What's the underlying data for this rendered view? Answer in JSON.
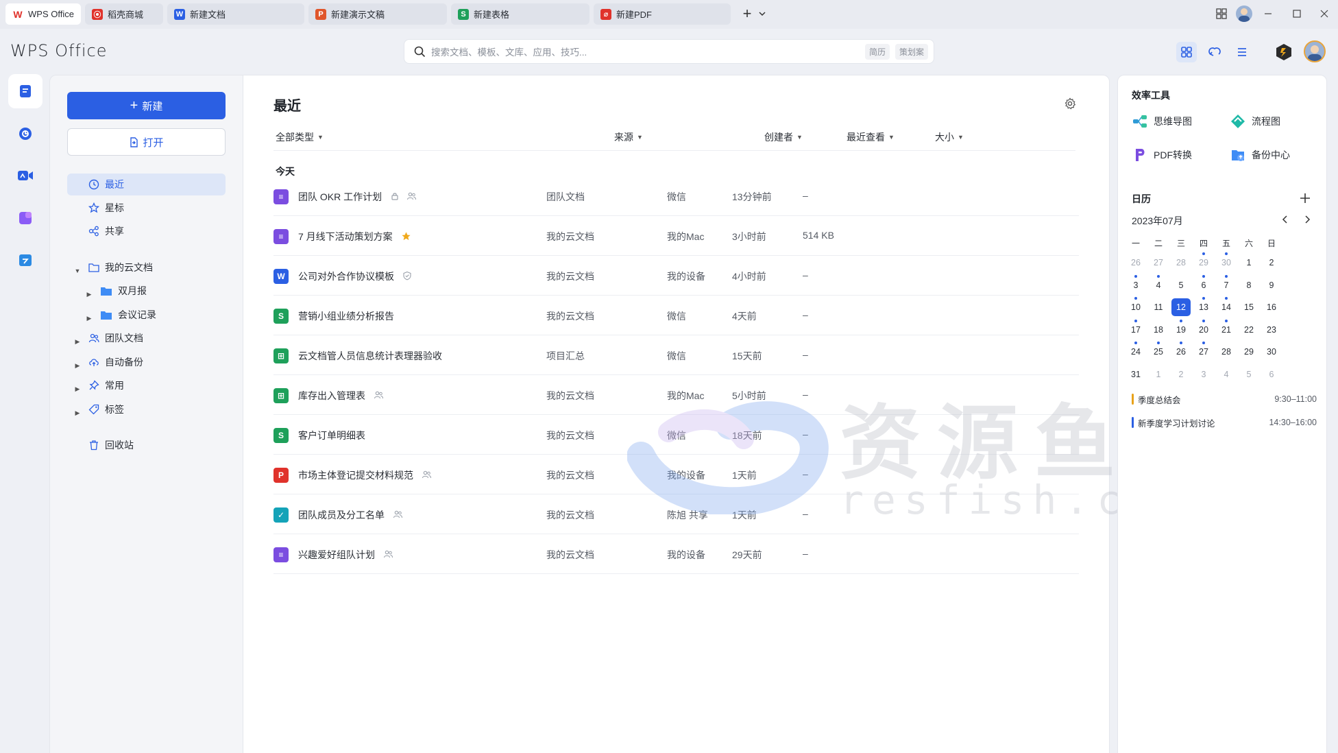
{
  "tabs": [
    {
      "label": "WPS Office",
      "badge": "W",
      "color": "#e0322b",
      "active": true
    },
    {
      "label": "稻壳商城",
      "badge": "D",
      "color": "#e0322b"
    },
    {
      "label": "新建文档",
      "badge": "W",
      "color": "#2b5fe3"
    },
    {
      "label": "新建演示文稿",
      "badge": "P",
      "color": "#e0562b"
    },
    {
      "label": "新建表格",
      "badge": "S",
      "color": "#1ea05a"
    },
    {
      "label": "新建PDF",
      "badge": "P",
      "color": "#e0322b"
    }
  ],
  "header": {
    "logo": "WPS Office",
    "search_placeholder": "搜索文档、模板、文库、应用、技巧...",
    "search_tags": [
      "简历",
      "策划案"
    ]
  },
  "nav": {
    "new_label": "新建",
    "open_label": "打开",
    "quick": [
      {
        "label": "最近",
        "icon": "clock-icon",
        "active": true
      },
      {
        "label": "星标",
        "icon": "star-icon"
      },
      {
        "label": "共享",
        "icon": "share-icon"
      }
    ],
    "tree": [
      {
        "label": "我的云文档",
        "level": 0,
        "expanded": true,
        "icon": "folder-icon"
      },
      {
        "label": "双月报",
        "level": 1,
        "icon": "folder-icon"
      },
      {
        "label": "会议记录",
        "level": 1,
        "icon": "folder-icon"
      },
      {
        "label": "团队文档",
        "level": 0,
        "icon": "team-icon"
      },
      {
        "label": "自动备份",
        "level": 0,
        "icon": "cloud-backup-icon"
      },
      {
        "label": "常用",
        "level": 0,
        "icon": "pin-icon"
      },
      {
        "label": "标签",
        "level": 0,
        "icon": "tag-icon"
      }
    ],
    "trash_label": "回收站"
  },
  "main": {
    "title": "最近",
    "columns": {
      "type": "全部类型",
      "source": "来源",
      "creator": "创建者",
      "viewed": "最近查看",
      "size": "大小"
    },
    "section": "今天",
    "files": [
      {
        "name": "团队 OKR 工作计划",
        "kind": "doc-purple",
        "badge": "≡",
        "meta": [
          "lock",
          "people"
        ],
        "source": "团队文档",
        "creator": "微信",
        "viewed": "13分钟前",
        "size": "–"
      },
      {
        "name": "7 月线下活动策划方案",
        "kind": "doc-purple",
        "badge": "≡",
        "meta": [
          "star"
        ],
        "source": "我的云文档",
        "creator": "我的Mac",
        "viewed": "3小时前",
        "size": "514 KB"
      },
      {
        "name": "公司对外合作协议模板",
        "kind": "word",
        "badge": "W",
        "meta": [
          "shield"
        ],
        "source": "我的云文档",
        "creator": "我的设备",
        "viewed": "4小时前",
        "size": "–"
      },
      {
        "name": "营销小组业绩分析报告",
        "kind": "sheet",
        "badge": "S",
        "meta": [],
        "source": "我的云文档",
        "creator": "微信",
        "viewed": "4天前",
        "size": "–"
      },
      {
        "name": "云文档管人员信息统计表理器验收",
        "kind": "table",
        "badge": "⊞",
        "meta": [],
        "source": "项目汇总",
        "creator": "微信",
        "viewed": "15天前",
        "size": "–"
      },
      {
        "name": "库存出入管理表",
        "kind": "table",
        "badge": "⊞",
        "meta": [
          "people"
        ],
        "source": "我的云文档",
        "creator": "我的Mac",
        "viewed": "5小时前",
        "size": "–"
      },
      {
        "name": "客户订单明细表",
        "kind": "sheet",
        "badge": "S",
        "meta": [],
        "source": "我的云文档",
        "creator": "微信",
        "viewed": "18天前",
        "size": "–"
      },
      {
        "name": "市场主体登记提交材料规范",
        "kind": "pdf",
        "badge": "P",
        "meta": [
          "people"
        ],
        "source": "我的云文档",
        "creator": "我的设备",
        "viewed": "1天前",
        "size": "–"
      },
      {
        "name": "团队成员及分工名单",
        "kind": "form",
        "badge": "✓",
        "meta": [
          "people"
        ],
        "source": "我的云文档",
        "creator": "陈旭 共享",
        "viewed": "1天前",
        "size": "–"
      },
      {
        "name": "兴趣爱好组队计划",
        "kind": "doc-purple",
        "badge": "≡",
        "meta": [
          "people"
        ],
        "source": "我的云文档",
        "creator": "我的设备",
        "viewed": "29天前",
        "size": "–"
      }
    ]
  },
  "tools": {
    "title": "效率工具",
    "items": [
      {
        "label": "思维导图",
        "icon": "mindmap-icon"
      },
      {
        "label": "流程图",
        "icon": "flowchart-icon"
      },
      {
        "label": "PDF转换",
        "icon": "pdf-convert-icon"
      },
      {
        "label": "备份中心",
        "icon": "backup-center-icon"
      }
    ]
  },
  "calendar": {
    "title": "日历",
    "month": "2023年07月",
    "weekdays": [
      "一",
      "二",
      "三",
      "四",
      "五",
      "六",
      "日"
    ],
    "weeks": [
      [
        "26",
        "27",
        "28",
        "29",
        "30",
        "1",
        "2"
      ],
      [
        "3",
        "4",
        "5",
        "6",
        "7",
        "8",
        "9"
      ],
      [
        "10",
        "11",
        "12",
        "13",
        "14",
        "15",
        "16"
      ],
      [
        "17",
        "18",
        "19",
        "20",
        "21",
        "22",
        "23"
      ],
      [
        "24",
        "25",
        "26",
        "27",
        "28",
        "29",
        "30"
      ],
      [
        "31",
        "1",
        "2",
        "3",
        "4",
        "5",
        "6"
      ]
    ],
    "today": "12",
    "events": [
      {
        "title": "季度总结会",
        "time": "9:30–11:00",
        "color": "#e8a21a"
      },
      {
        "title": "新季度学习计划讨论",
        "time": "14:30–16:00",
        "color": "#2b5fe3"
      }
    ]
  },
  "watermark": {
    "cn": "资源鱼",
    "en": "resfish.com"
  },
  "colors": {
    "accent": "#2b5fe3",
    "star": "#f0a91b"
  }
}
